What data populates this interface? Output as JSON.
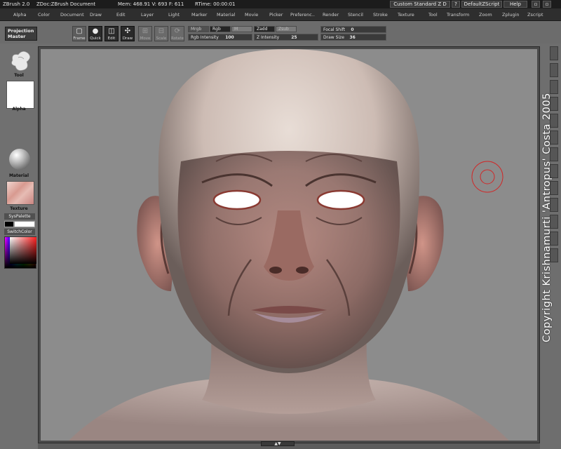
{
  "titlebar": {
    "app": "ZBrush 2.0",
    "doc": "ZDoc:ZBrush Document",
    "mem": "Mem: 468.91 V: 693 F: 611",
    "rtime": "RTime: 00:00:01",
    "layout": "Custom Standard Z D",
    "help_q": "?",
    "zscript": "DefaultZScript",
    "help": "Help",
    "minimize": "▫",
    "close": "▫"
  },
  "menus": [
    "Alpha",
    "Color",
    "Document",
    "Draw",
    "Edit",
    "Layer",
    "Light",
    "Marker",
    "Material",
    "Movie",
    "Picker",
    "Preferenc..",
    "Render",
    "Stencil",
    "Stroke",
    "Texture",
    "Tool",
    "Transform",
    "Zoom",
    "Zplugin",
    "Zscript"
  ],
  "shelf": {
    "projection_master": "Projection Master",
    "tools": [
      {
        "label": "Frame",
        "icon": "▢",
        "state": "normal"
      },
      {
        "label": "Quick",
        "icon": "●",
        "state": "active"
      },
      {
        "label": "Edit",
        "icon": "◫",
        "state": "active"
      },
      {
        "label": "Draw",
        "icon": "✣",
        "state": "active"
      },
      {
        "label": "Move",
        "icon": "⊞",
        "state": "dim"
      },
      {
        "label": "Scale",
        "icon": "⊟",
        "state": "dim"
      },
      {
        "label": "Rotate",
        "icon": "⟳",
        "state": "dim"
      }
    ],
    "mrgb": "Mrgb",
    "rgb": "Rgb",
    "m": "M",
    "zadd": "Zadd",
    "zsub": "Zsub",
    "rgb_intensity_label": "Rgb Intensity",
    "rgb_intensity_value": "100",
    "z_intensity_label": "Z Intensity",
    "z_intensity_value": "25",
    "focal_shift_label": "Focal Shift",
    "focal_shift_value": "0",
    "draw_size_label": "Draw Size",
    "draw_size_value": "36"
  },
  "lefttray": {
    "tool": "Tool",
    "alpha": "Alpha",
    "material": "Material",
    "texture": "Texture",
    "syspalette": "SysPalette",
    "switchcolor": "SwitchColor"
  },
  "copyright": "Copyright Krishnamurti 'Antropus' Costa 2005",
  "colors": {
    "ui_dark": "#2e2e2e",
    "canvas_bg": "#8c8c8c",
    "skin": "#b58a80",
    "cursor_ring": "#d02828"
  }
}
